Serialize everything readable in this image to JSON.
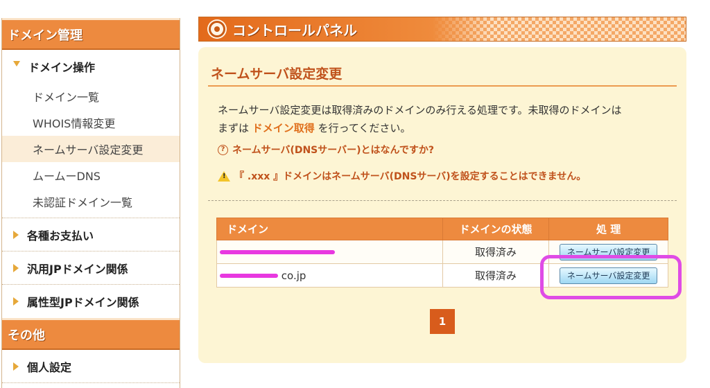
{
  "sidebar": {
    "domain_header": "ドメイン管理",
    "domain_ops_label": "ドメイン操作",
    "domain_ops_items": [
      {
        "label": "ドメイン一覧"
      },
      {
        "label": "WHOIS情報変更"
      },
      {
        "label": "ネームサーバ設定変更"
      },
      {
        "label": "ムームーDNS"
      },
      {
        "label": "未認証ドメイン一覧"
      }
    ],
    "payments_label": "各種お支払い",
    "jp_label": "汎用JPドメイン関係",
    "attr_jp_label": "属性型JPドメイン関係",
    "other_header": "その他",
    "personal_label": "個人設定"
  },
  "banner": {
    "title": "コントロールパネル",
    "icon": "gear-icon"
  },
  "page": {
    "title": "ネームサーバ設定変更",
    "desc_line1": "ネームサーバ設定変更は取得済みのドメインのみ行える処理です。未取得のドメインは",
    "desc_prefix": "まずは",
    "desc_link": "ドメイン取得",
    "desc_suffix": "を行ってください。",
    "faq_icon_text": "?",
    "faq_link": "ネームサーバ(DNSサーバー)とはなんですか?",
    "warning_text": "『 .xxx 』ドメインはネームサーバ(DNSサーバ)を設定することはできません。"
  },
  "table": {
    "headers": {
      "domain": "ドメイン",
      "status": "ドメインの状態",
      "action": "処  理"
    },
    "rows": [
      {
        "domain_suffix": "",
        "status": "取得済み",
        "action_label": "ネームサーバ設定変更"
      },
      {
        "domain_suffix": "co.jp",
        "status": "取得済み",
        "action_label": "ネームサーバ設定変更"
      }
    ]
  },
  "pagination": {
    "current_page": "1"
  },
  "colors": {
    "accent": "#ed8a3f",
    "panel_bg": "#fdf5d4",
    "title_text": "#c0521c",
    "highlight": "#df4ce6",
    "redaction": "#e838e0"
  }
}
